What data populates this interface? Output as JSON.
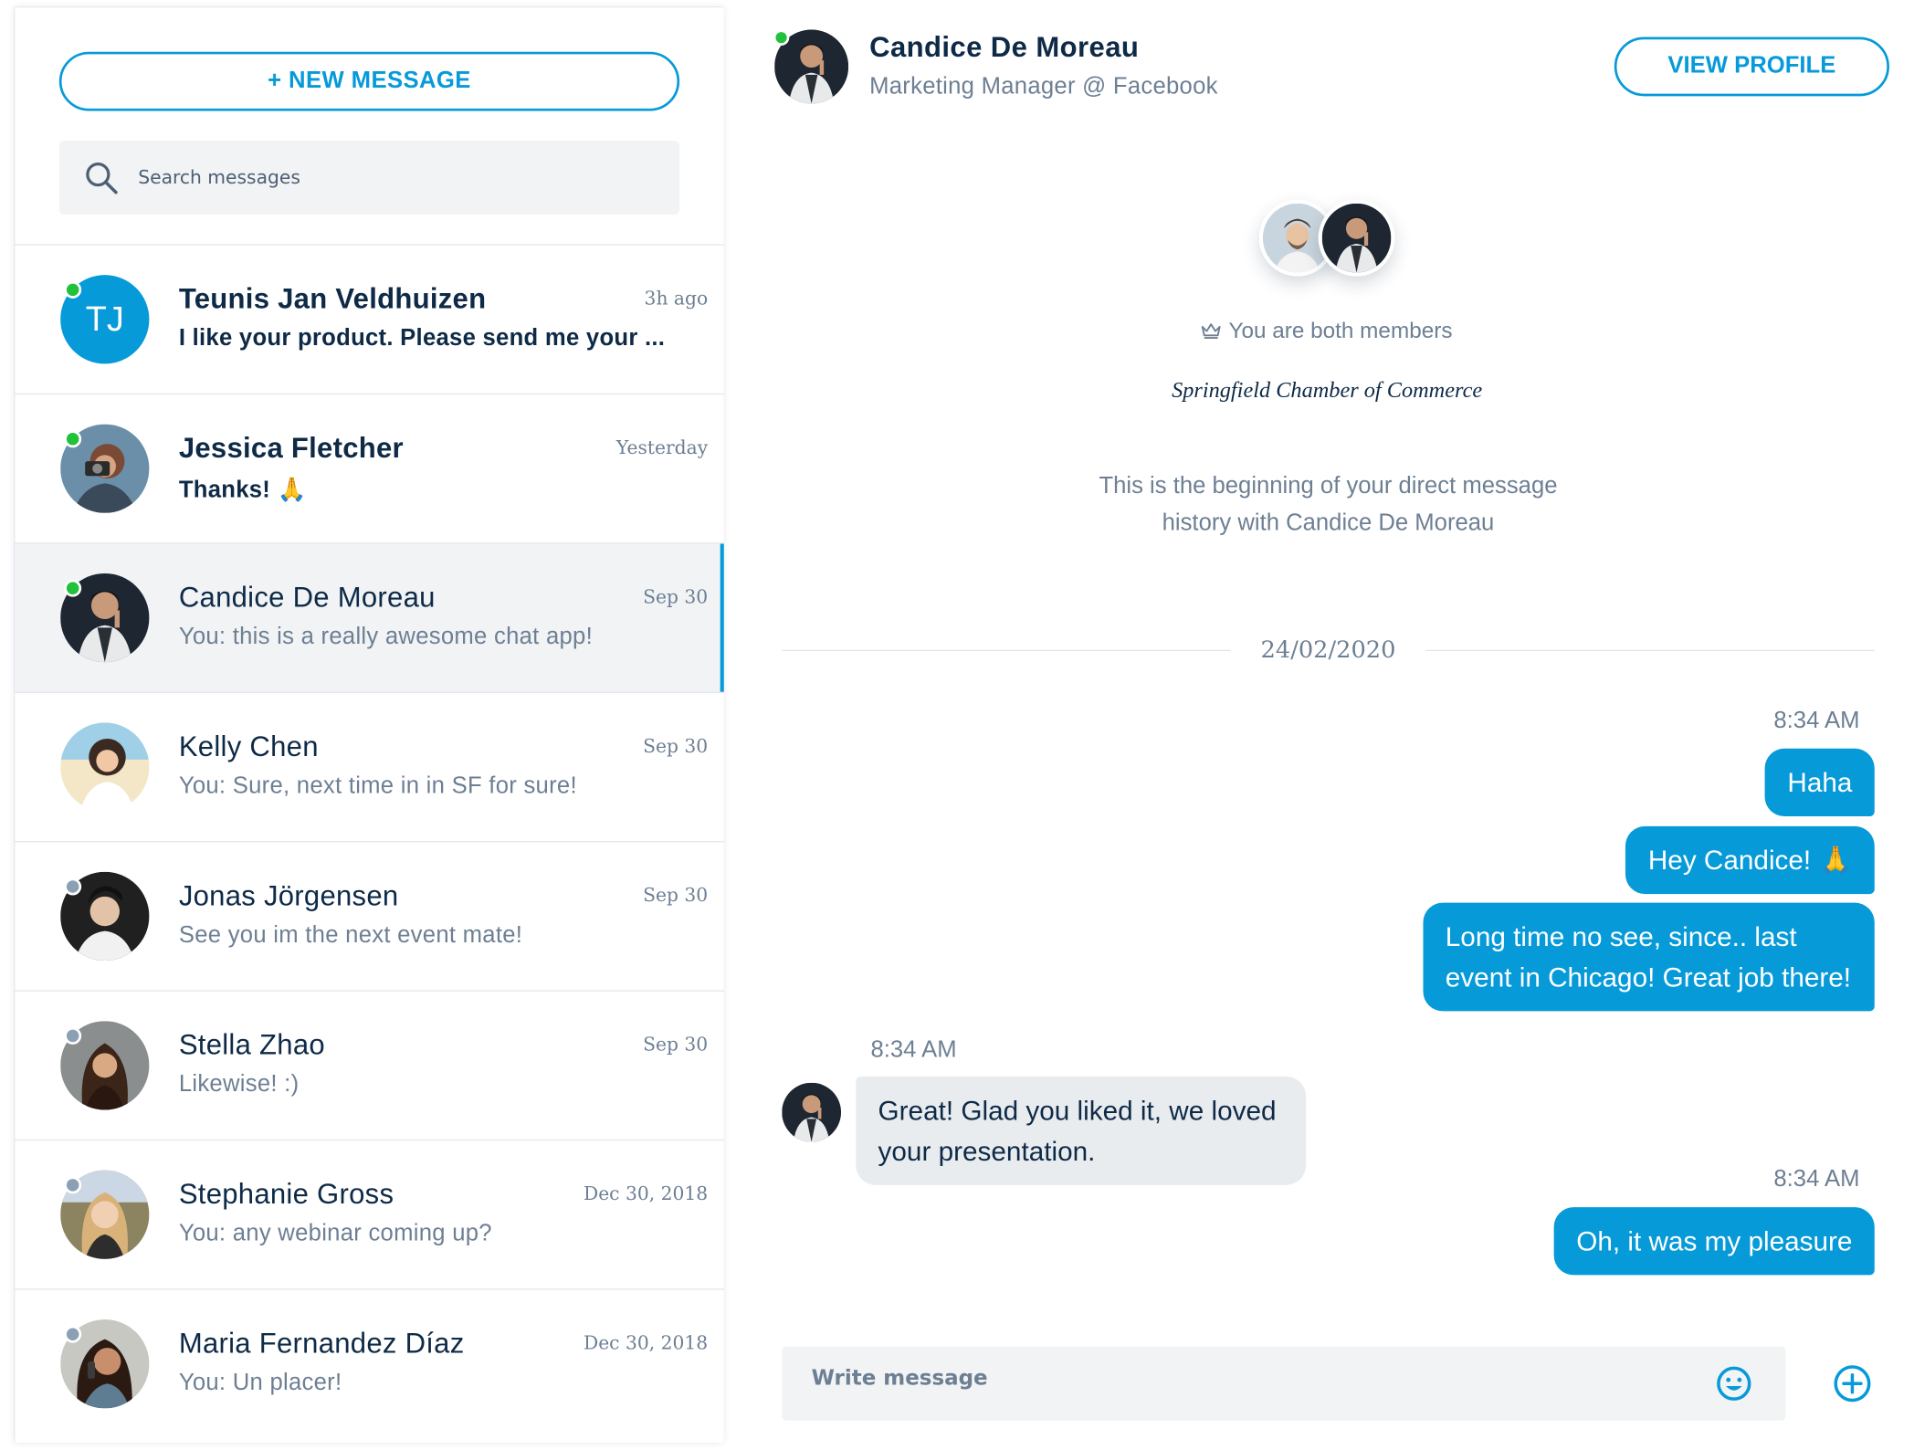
{
  "sidebar": {
    "new_message_label": "+ NEW MESSAGE",
    "search_placeholder": "Search messages",
    "conversations": [
      {
        "name": "Teunis Jan Veldhuizen",
        "preview": "I like your product. Please send me your ...",
        "time": "3h ago",
        "status": "online",
        "unread": true,
        "initials": "TJ",
        "avatar": "initials-avatar"
      },
      {
        "name": "Jessica Fletcher",
        "preview": "Thanks! 🙏",
        "time": "Yesterday",
        "status": "online",
        "unread": true,
        "avatar": "photo-avatar"
      },
      {
        "name": "Candice De Moreau",
        "preview": "You: this is a really awesome chat app!",
        "time": "Sep 30",
        "status": "online",
        "unread": false,
        "active": true,
        "avatar": "photo-avatar"
      },
      {
        "name": "Kelly Chen",
        "preview": "You: Sure, next time in in SF for sure!",
        "time": "Sep 30",
        "status": "none",
        "unread": false,
        "avatar": "photo-avatar"
      },
      {
        "name": "Jonas Jörgensen",
        "preview": "See you im the next event mate!",
        "time": "Sep 30",
        "status": "offline",
        "unread": false,
        "avatar": "photo-avatar"
      },
      {
        "name": "Stella Zhao",
        "preview": "Likewise! :)",
        "time": "Sep 30",
        "status": "offline",
        "unread": false,
        "avatar": "photo-avatar"
      },
      {
        "name": "Stephanie Gross",
        "preview": "You: any webinar coming up?",
        "time": "Dec 30, 2018",
        "status": "offline",
        "unread": false,
        "avatar": "photo-avatar"
      },
      {
        "name": "Maria Fernandez Díaz",
        "preview": "You: Un placer!",
        "time": "Dec 30, 2018",
        "status": "offline",
        "unread": false,
        "avatar": "photo-avatar"
      }
    ]
  },
  "chat": {
    "contact_name": "Candice De Moreau",
    "contact_role": "Marketing Manager @ Facebook",
    "view_profile_label": "VIEW PROFILE",
    "members_text": "You are both members",
    "organization": "Springfield Chamber of Commerce",
    "beginning_text": "This is the beginning of your direct message history with Candice De Moreau",
    "date": "24/02/2020",
    "messages": [
      {
        "direction": "out",
        "time": "8:34 AM",
        "text": "Haha"
      },
      {
        "direction": "out",
        "text": "Hey Candice! 🙏"
      },
      {
        "direction": "out",
        "text": "Long time no see, since.. last event in Chicago! Great job there!"
      },
      {
        "direction": "in",
        "time": "8:34 AM",
        "text": "Great! Glad you liked it, we loved your presentation."
      },
      {
        "direction": "out",
        "time": "8:34 AM",
        "text": "Oh, it was my pleasure"
      }
    ],
    "composer_placeholder": "Write message"
  },
  "colors": {
    "accent": "#069ad9",
    "online": "#1fc238",
    "offline": "#8ba0b4",
    "text": "#0e2a47",
    "muted": "#6d7f93"
  },
  "icons": [
    "search-icon",
    "crown-icon",
    "emoji-icon",
    "plus-circle-icon"
  ]
}
